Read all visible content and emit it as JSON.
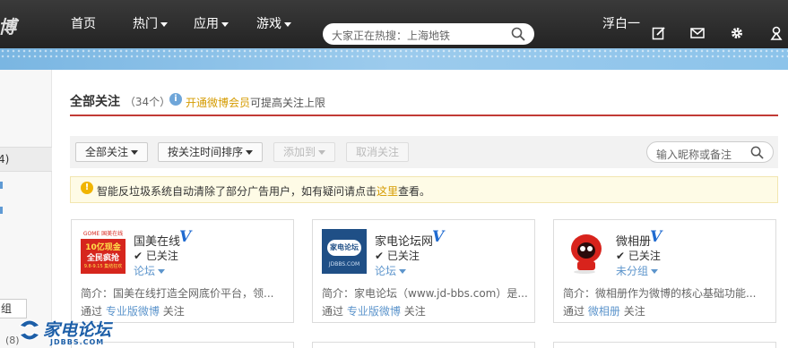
{
  "topnav": {
    "logo": "博",
    "items": [
      "首页",
      "热门",
      "应用",
      "游戏"
    ],
    "search_placeholder": "大家正在热搜：上海地铁",
    "user": "浮白一"
  },
  "sidebar": {
    "count_fragment": "4)",
    "button_fragment": "组",
    "footer_fragment": "(8)"
  },
  "header": {
    "title": "全部关注",
    "count": "（34个）",
    "vip_link": "开通微博会员",
    "vip_text": "可提高关注上限"
  },
  "toolbar": {
    "all": "全部关注",
    "sort": "按关注时间排序",
    "add_to": "添加到",
    "unfollow": "取消关注",
    "filter_placeholder": "输入昵称或备注"
  },
  "notice": {
    "before": "智能反垃圾系统自动清除了部分广告用户，如有疑问请点击",
    "link": "这里",
    "after": "查看。"
  },
  "cards": [
    {
      "name": "国美在线",
      "status": "已关注",
      "group": "论坛",
      "desc": "简介：国美在线打造全网底价平台，领...",
      "via_prefix": "通过",
      "source": "专业版微博",
      "via_suffix": "关注",
      "avatar_lines": [
        "10亿现金",
        "全民疯抢",
        "9.8-9.15 集结狂欢"
      ],
      "avatar_top": "GOME 国美在线"
    },
    {
      "name": "家电论坛网",
      "status": "已关注",
      "group": "论坛",
      "desc": "简介：家电论坛（www.jd-bbs.com）是...",
      "via_prefix": "通过",
      "source": "专业版微博",
      "via_suffix": "关注",
      "avatar_lines": [
        "家电论坛",
        "JDBBS.COM"
      ]
    },
    {
      "name": "微相册",
      "status": "已关注",
      "group": "未分组",
      "desc": "简介：微相册作为微博的核心基础功能...",
      "via_prefix": "通过",
      "source": "微相册",
      "via_suffix": "关注"
    }
  ],
  "watermark": {
    "title": "家电论坛",
    "sub": "JDBBS.COM"
  },
  "colors": {
    "nav_bg": "#2b2b2b",
    "band": "#8cc3ea",
    "accent_red": "#c23a35",
    "link_blue": "#5d95cc",
    "vip_gold": "#d59b00",
    "verified_blue": "#1f6ad0"
  }
}
